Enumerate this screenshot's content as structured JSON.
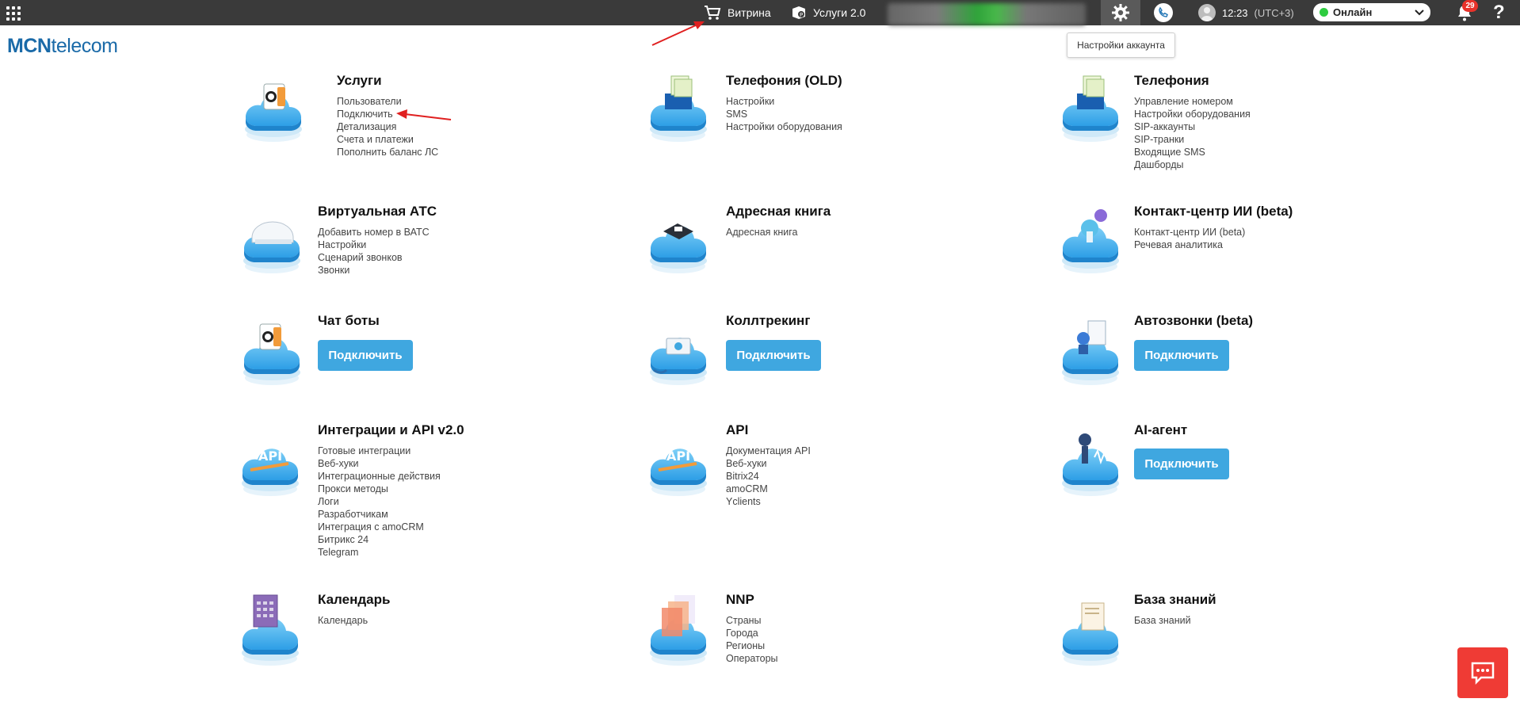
{
  "colors": {
    "topbar": "#3a3a3a",
    "accent": "#3fa7e0",
    "online": "#2ecc40",
    "alert": "#e8322a",
    "logo": "#1a6aa8"
  },
  "topbar": {
    "showcase_label": "Витрина",
    "services2_label": "Услуги 2.0",
    "time": "12:23",
    "timezone": "(UTC+3)",
    "status": "Онлайн",
    "notifications_count": "29",
    "help_label": "?"
  },
  "tooltip": "Настройки аккаунта",
  "logo": {
    "bold": "MCN",
    "rest": "telecom"
  },
  "cards": {
    "uslugi": {
      "title": "Услуги",
      "items": [
        "Пользователи",
        "Подключить",
        "Детализация",
        "Счета и платежи",
        "Пополнить баланс ЛС"
      ]
    },
    "telephony_old": {
      "title": "Телефония (OLD)",
      "items": [
        "Настройки",
        "SMS",
        "Настройки оборудования"
      ]
    },
    "telephony": {
      "title": "Телефония",
      "items": [
        "Управление номером",
        "Настройки оборудования",
        "SIP-аккаунты",
        "SIP-транки",
        "Входящие SMS",
        "Дашборды"
      ]
    },
    "vats": {
      "title": "Виртуальная АТС",
      "items": [
        "Добавить номер в ВАТС",
        "Настройки",
        "Сценарий звонков",
        "Звонки"
      ]
    },
    "address_book": {
      "title": "Адресная книга",
      "items": [
        "Адресная книга"
      ]
    },
    "contact_center": {
      "title": "Контакт-центр ИИ (beta)",
      "items": [
        "Контакт-центр ИИ (beta)",
        "Речевая аналитика"
      ]
    },
    "chat_bots": {
      "title": "Чат боты",
      "button": "Подключить"
    },
    "calltracking": {
      "title": "Коллтрекинг",
      "button": "Подключить"
    },
    "autocalls": {
      "title": "Автозвонки (beta)",
      "button": "Подключить"
    },
    "integrations": {
      "title": "Интеграции и API v2.0",
      "items": [
        "Готовые интеграции",
        "Веб-хуки",
        "Интеграционные действия",
        "Прокси методы",
        "Логи",
        "Разработчикам",
        "Интеграция с amoCRM",
        "Битрикс 24",
        "Telegram"
      ]
    },
    "api": {
      "title": "API",
      "items": [
        "Документация API",
        "Веб-хуки",
        "Bitrix24",
        "amoCRM",
        "Yclients"
      ]
    },
    "ai_agent": {
      "title": "AI-агент",
      "button": "Подключить"
    },
    "calendar": {
      "title": "Календарь",
      "items": [
        "Календарь"
      ]
    },
    "nnp": {
      "title": "NNP",
      "items": [
        "Страны",
        "Города",
        "Регионы",
        "Операторы"
      ]
    },
    "knowledge": {
      "title": "База знаний",
      "items": [
        "База знаний"
      ]
    }
  }
}
